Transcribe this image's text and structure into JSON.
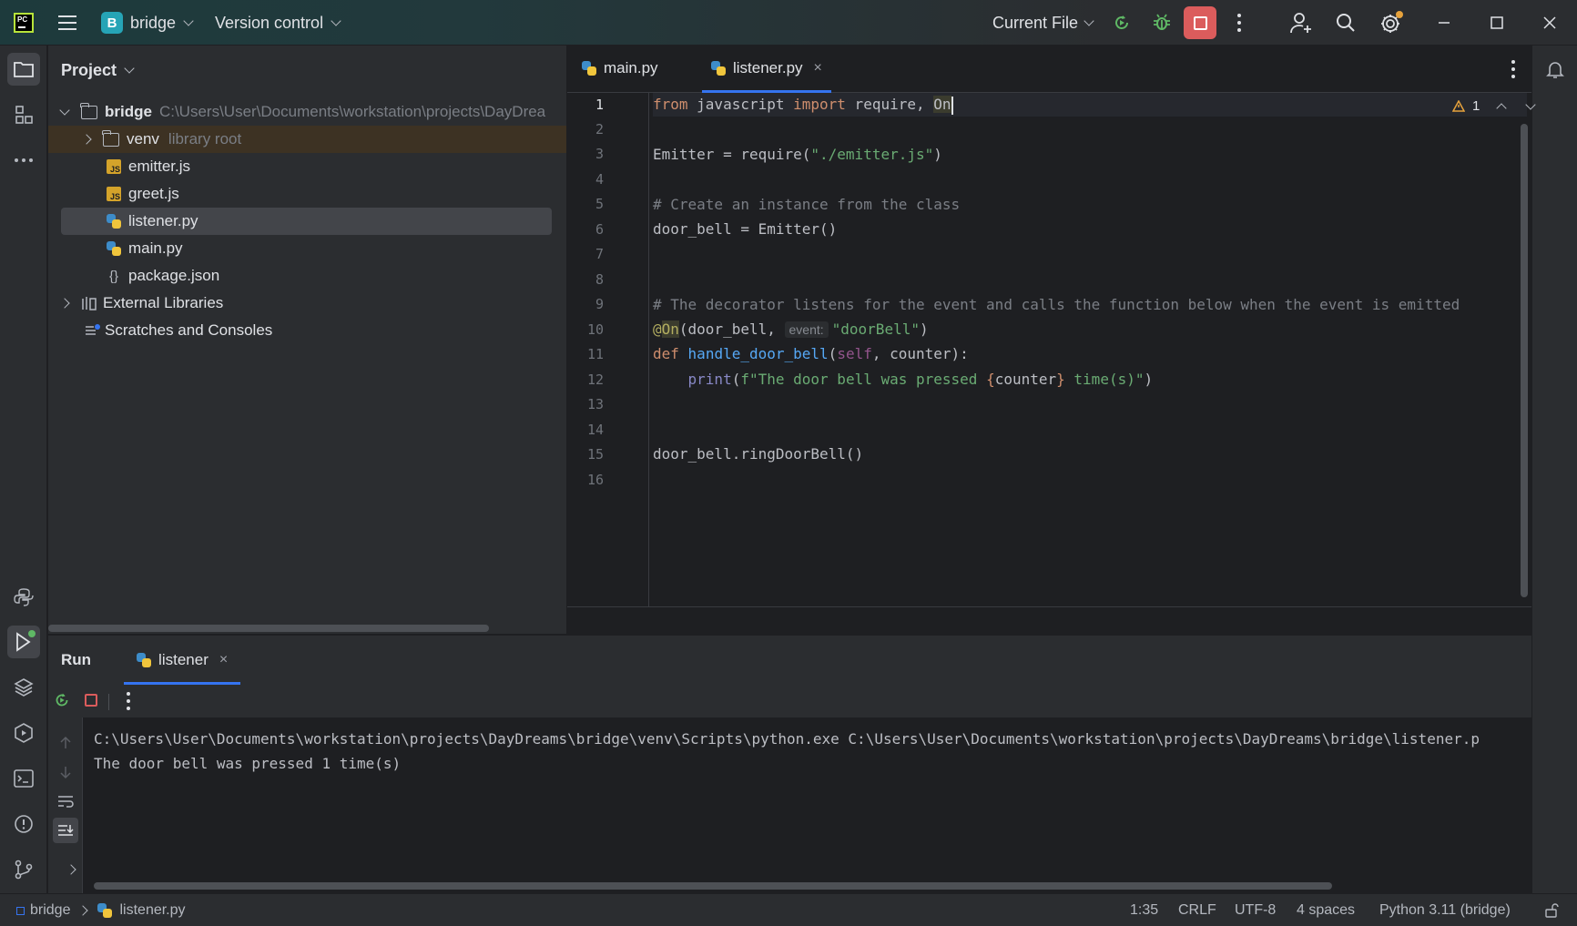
{
  "titlebar": {
    "project_badge": "B",
    "project_name": "bridge",
    "vcs_label": "Version control",
    "run_config": "Current File"
  },
  "project_panel": {
    "title": "Project",
    "root_name": "bridge",
    "root_path": "C:\\Users\\User\\Documents\\workstation\\projects\\DayDrea",
    "venv_name": "venv",
    "venv_note": "library root",
    "files": [
      "emitter.js",
      "greet.js",
      "listener.py",
      "main.py",
      "package.json"
    ],
    "external_libraries": "External Libraries",
    "scratches": "Scratches and Consoles"
  },
  "editor": {
    "tabs": [
      {
        "label": "main.py"
      },
      {
        "label": "listener.py",
        "close": "×"
      }
    ],
    "warning_count": "1",
    "line_numbers": [
      "1",
      "2",
      "3",
      "4",
      "5",
      "6",
      "7",
      "8",
      "9",
      "10",
      "11",
      "12",
      "13",
      "14",
      "15",
      "16"
    ],
    "hint_event": "event:",
    "code": {
      "l1_from": "from",
      "l1_module": " javascript ",
      "l1_import": "import",
      "l1_names": " require, ",
      "l1_on": "On",
      "l3_a": "Emitter = require(",
      "l3_str": "\"./emitter.js\"",
      "l3_b": ")",
      "l5": "# Create an instance from the class",
      "l6": "door_bell = Emitter()",
      "l9": "# The decorator listens for the event and calls the function below when the event is emitted",
      "l10_at": "@",
      "l10_on": "On",
      "l10_a": "(door_bell, ",
      "l10_str": "\"doorBell\"",
      "l10_b": ")",
      "l11_def": "def",
      "l11_fn": "handle_door_bell",
      "l11_a": "(",
      "l11_self": "self",
      "l11_b": ", counter):",
      "l12_print": "print",
      "l12_a": "(",
      "l12_f": "f\"The door bell was pressed ",
      "l12_lb": "{",
      "l12_var": "counter",
      "l12_rb": "}",
      "l12_end": " time(s)\"",
      "l12_close": ")",
      "l15": "door_bell.ringDoorBell()"
    }
  },
  "run_panel": {
    "title": "Run",
    "tab_label": "listener",
    "tab_close": "×",
    "console_lines": [
      "C:\\Users\\User\\Documents\\workstation\\projects\\DayDreams\\bridge\\venv\\Scripts\\python.exe C:\\Users\\User\\Documents\\workstation\\projects\\DayDreams\\bridge\\listener.p",
      "The door bell was pressed 1 time(s)"
    ]
  },
  "statusbar": {
    "breadcrumb_project": "bridge",
    "breadcrumb_file": "listener.py",
    "cursor_pos": "1:35",
    "line_sep": "CRLF",
    "encoding": "UTF-8",
    "indent": "4 spaces",
    "interpreter": "Python 3.11 (bridge)"
  },
  "colors": {
    "accent": "#3574f0",
    "stop_red": "#db5c5c",
    "run_green": "#5fb865",
    "keyword": "#cf8e6d",
    "string": "#6aab73",
    "comment": "#7a7e85",
    "function": "#56a8f5"
  },
  "icons": [
    "app-logo-icon",
    "menu-icon",
    "chevron-down-icon",
    "rerun-icon",
    "debug-icon",
    "stop-icon",
    "more-icon",
    "add-user-icon",
    "search-icon",
    "settings-icon",
    "minimize-icon",
    "maximize-icon",
    "close-icon",
    "folder-icon",
    "structure-icon",
    "python-console-icon",
    "run-icon",
    "layers-icon",
    "services-icon",
    "terminal-icon",
    "problems-icon",
    "git-icon",
    "notifications-icon",
    "warning-icon",
    "python-file-icon",
    "js-file-icon",
    "json-file-icon",
    "library-icon",
    "scratches-icon"
  ]
}
